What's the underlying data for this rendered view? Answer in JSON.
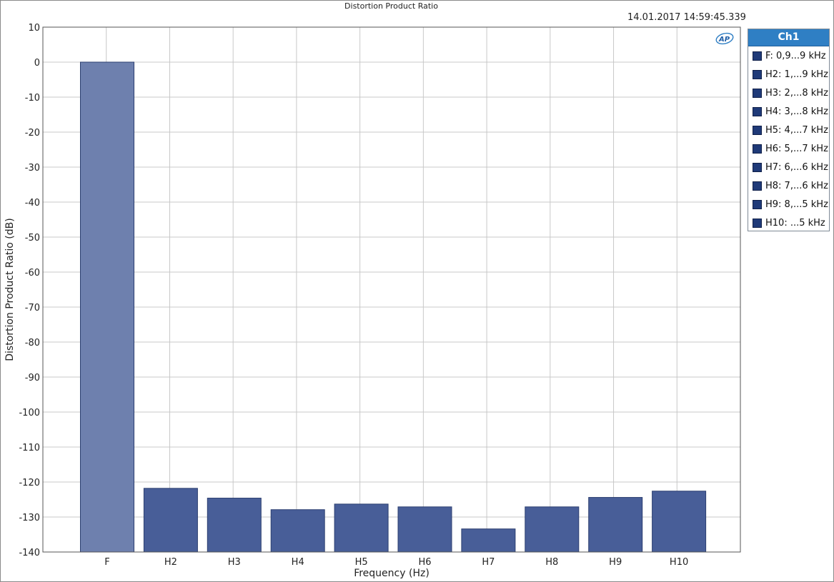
{
  "timestamp": "14.01.2017 14:59:45.339",
  "logo_text": "AP",
  "legend": {
    "header": "Ch1",
    "items": [
      {
        "label": "F: 0,9...9 kHz"
      },
      {
        "label": "H2: 1,...9 kHz"
      },
      {
        "label": "H3: 2,...8 kHz"
      },
      {
        "label": "H4: 3,...8 kHz"
      },
      {
        "label": "H5: 4,...7 kHz"
      },
      {
        "label": "H6: 5,...7 kHz"
      },
      {
        "label": "H7: 6,...6 kHz"
      },
      {
        "label": "H8: 7,...6 kHz"
      },
      {
        "label": "H9: 8,...5 kHz"
      },
      {
        "label": "H10: ...5 kHz"
      }
    ]
  },
  "colors": {
    "fundamental_bar": "#6e80ae",
    "harmonic_bar": "#485e98",
    "bar_edge": "#2c3f70",
    "grid": "#c8c8c8",
    "legend_header": "#2f7fc4",
    "legend_swatch": "#1f3a78"
  },
  "chart_data": {
    "type": "bar",
    "title": "Distortion Product Ratio",
    "xlabel": "Frequency (Hz)",
    "ylabel": "Distortion Product Ratio (dB)",
    "categories": [
      "F",
      "H2",
      "H3",
      "H4",
      "H5",
      "H6",
      "H7",
      "H8",
      "H9",
      "H10"
    ],
    "series": [
      {
        "name": "Ch1",
        "values": [
          0,
          -121.8,
          -124.6,
          -127.9,
          -126.3,
          -127.1,
          -133.4,
          -127.1,
          -124.4,
          -122.6
        ]
      }
    ],
    "ylim": [
      -140,
      10
    ],
    "yticks": [
      10,
      0,
      -10,
      -20,
      -30,
      -40,
      -50,
      -60,
      -70,
      -80,
      -90,
      -100,
      -110,
      -120,
      -130,
      -140
    ],
    "grid": true,
    "legend_position": "right"
  }
}
